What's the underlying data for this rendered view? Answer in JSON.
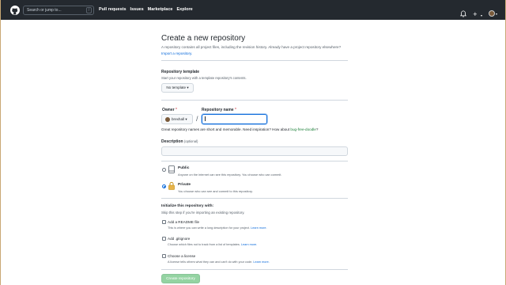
{
  "header": {
    "search_placeholder": "Search or jump to...",
    "search_key": "/",
    "nav": [
      "Pull requests",
      "Issues",
      "Marketplace",
      "Explore"
    ],
    "plus": "+",
    "caret": "▾"
  },
  "page": {
    "title": "Create a new repository",
    "intro_text": "A repository contains all project files, including the revision history. Already have a project repository elsewhere?",
    "import_link": "Import a repository."
  },
  "template": {
    "label": "Repository template",
    "note": "Start your repository with a template repository's contents.",
    "button": "No template ▾"
  },
  "owner": {
    "label": "Owner",
    "required": "*",
    "value": "brexhall ▾"
  },
  "repo_name": {
    "label": "Repository name",
    "required": "*",
    "value": "",
    "separator": "/"
  },
  "name_hint": {
    "text": "Great repository names are short and memorable. Need inspiration? How about",
    "suggestion": "bug-free-doodle",
    "end": "?"
  },
  "description": {
    "label": "Description",
    "optional": "(optional)",
    "value": ""
  },
  "visibility": {
    "public_label": "Public",
    "public_note": "Anyone on the internet can see this repository. You choose who can commit.",
    "private_label": "Private",
    "private_note": "You choose who can see and commit to this repository.",
    "selected": "private"
  },
  "init": {
    "label": "Initialize this repository with:",
    "note": "Skip this step if you're importing an existing repository.",
    "readme_label": "Add a README file",
    "readme_note": "This is where you can write a long description for your project.",
    "readme_link": "Learn more.",
    "gitignore_label": "Add .gitignore",
    "gitignore_note": "Choose which files not to track from a list of templates.",
    "gitignore_link": "Learn more.",
    "license_label": "Choose a license",
    "license_note": "A license tells others what they can and can't do with your code.",
    "license_link": "Learn more."
  },
  "submit": {
    "label": "Create repository"
  },
  "colors": {
    "header_bg": "#24292f",
    "link": "#0969da",
    "create_button_disabled": "#94d3a2",
    "required": "#cf222e",
    "suggestion": "#1a7f37"
  }
}
